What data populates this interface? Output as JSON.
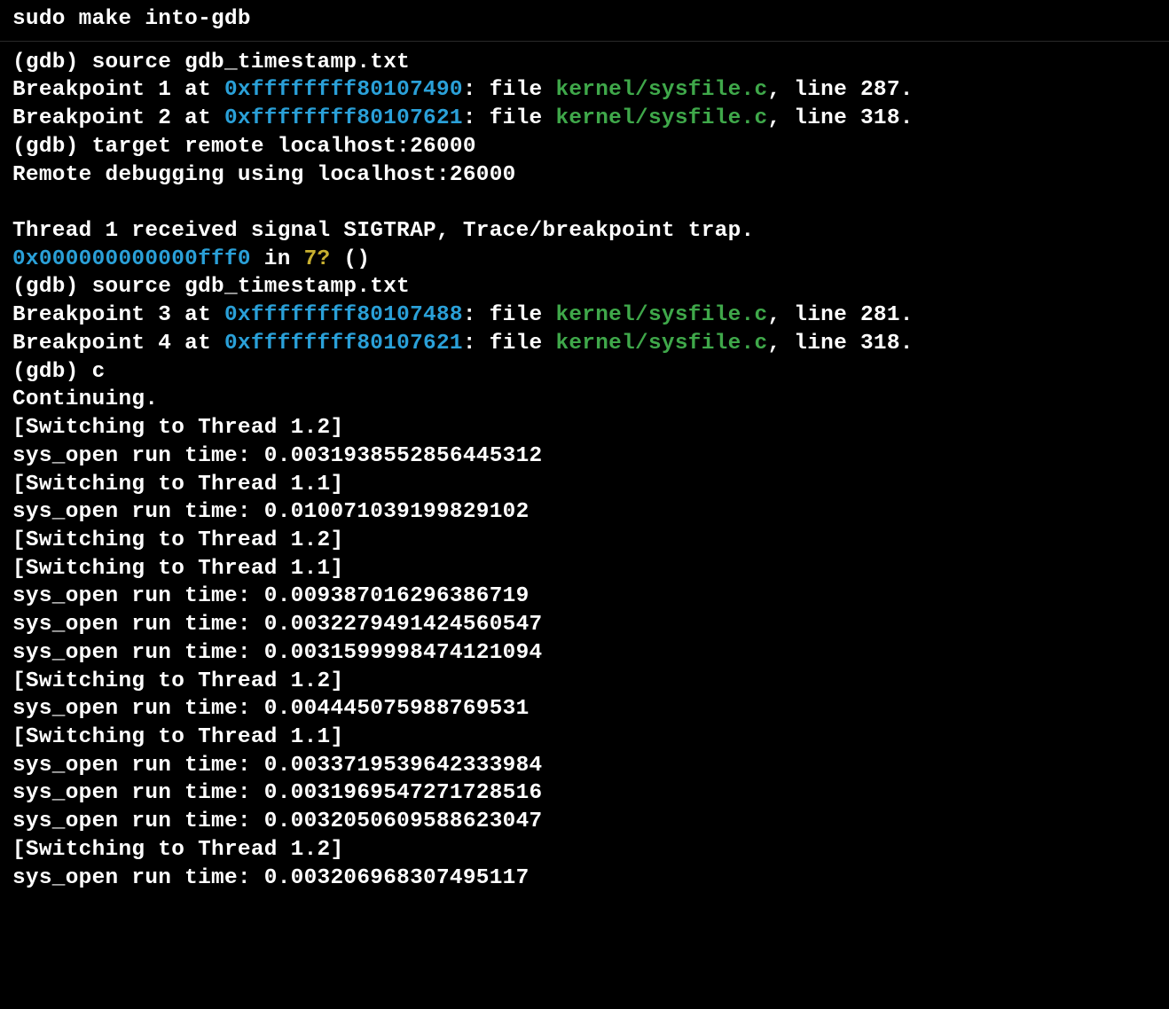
{
  "title": "sudo make into-gdb",
  "lines": [
    {
      "segments": [
        {
          "t": "(gdb) source gdb_timestamp.txt"
        }
      ]
    },
    {
      "segments": [
        {
          "t": "Breakpoint 1 at "
        },
        {
          "t": "0xffffffff80107490",
          "cls": "addr"
        },
        {
          "t": ": file "
        },
        {
          "t": "kernel/sysfile.c",
          "cls": "file"
        },
        {
          "t": ", line 287."
        }
      ]
    },
    {
      "segments": [
        {
          "t": "Breakpoint 2 at "
        },
        {
          "t": "0xffffffff80107621",
          "cls": "addr"
        },
        {
          "t": ": file "
        },
        {
          "t": "kernel/sysfile.c",
          "cls": "file"
        },
        {
          "t": ", line 318."
        }
      ]
    },
    {
      "segments": [
        {
          "t": "(gdb) target remote localhost:26000"
        }
      ]
    },
    {
      "segments": [
        {
          "t": "Remote debugging using localhost:26000"
        }
      ]
    },
    {
      "segments": [
        {
          "t": ""
        }
      ]
    },
    {
      "segments": [
        {
          "t": "Thread 1 received signal SIGTRAP, Trace/breakpoint trap."
        }
      ]
    },
    {
      "segments": [
        {
          "t": "0x000000000000fff0",
          "cls": "addr"
        },
        {
          "t": " in "
        },
        {
          "t": "??",
          "cls": "unknown"
        },
        {
          "t": " ()"
        }
      ]
    },
    {
      "segments": [
        {
          "t": "(gdb) source gdb_timestamp.txt"
        }
      ]
    },
    {
      "segments": [
        {
          "t": "Breakpoint 3 at "
        },
        {
          "t": "0xffffffff80107488",
          "cls": "addr"
        },
        {
          "t": ": file "
        },
        {
          "t": "kernel/sysfile.c",
          "cls": "file"
        },
        {
          "t": ", line 281."
        }
      ]
    },
    {
      "segments": [
        {
          "t": "Breakpoint 4 at "
        },
        {
          "t": "0xffffffff80107621",
          "cls": "addr"
        },
        {
          "t": ": file "
        },
        {
          "t": "kernel/sysfile.c",
          "cls": "file"
        },
        {
          "t": ", line 318."
        }
      ]
    },
    {
      "segments": [
        {
          "t": "(gdb) c"
        }
      ]
    },
    {
      "segments": [
        {
          "t": "Continuing."
        }
      ]
    },
    {
      "segments": [
        {
          "t": "[Switching to Thread 1.2]"
        }
      ]
    },
    {
      "segments": [
        {
          "t": "sys_open run time: 0.0031938552856445312"
        }
      ]
    },
    {
      "segments": [
        {
          "t": "[Switching to Thread 1.1]"
        }
      ]
    },
    {
      "segments": [
        {
          "t": "sys_open run time: 0.010071039199829102"
        }
      ]
    },
    {
      "segments": [
        {
          "t": "[Switching to Thread 1.2]"
        }
      ]
    },
    {
      "segments": [
        {
          "t": "[Switching to Thread 1.1]"
        }
      ]
    },
    {
      "segments": [
        {
          "t": "sys_open run time: 0.009387016296386719"
        }
      ]
    },
    {
      "segments": [
        {
          "t": "sys_open run time: 0.0032279491424560547"
        }
      ]
    },
    {
      "segments": [
        {
          "t": "sys_open run time: 0.0031599998474121094"
        }
      ]
    },
    {
      "segments": [
        {
          "t": "[Switching to Thread 1.2]"
        }
      ]
    },
    {
      "segments": [
        {
          "t": "sys_open run time: 0.004445075988769531"
        }
      ]
    },
    {
      "segments": [
        {
          "t": "[Switching to Thread 1.1]"
        }
      ]
    },
    {
      "segments": [
        {
          "t": "sys_open run time: 0.0033719539642333984"
        }
      ]
    },
    {
      "segments": [
        {
          "t": "sys_open run time: 0.0031969547271728516"
        }
      ]
    },
    {
      "segments": [
        {
          "t": "sys_open run time: 0.0032050609588623047"
        }
      ]
    },
    {
      "segments": [
        {
          "t": "[Switching to Thread 1.2]"
        }
      ]
    },
    {
      "segments": [
        {
          "t": "sys_open run time: 0.00320696830749511?"
        }
      ]
    }
  ]
}
